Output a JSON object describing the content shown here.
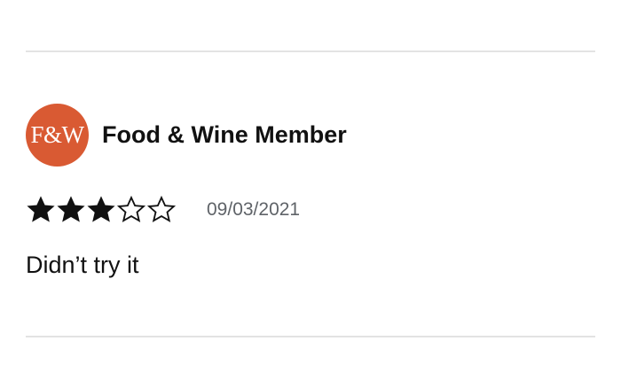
{
  "review": {
    "avatar_text": "F&W",
    "avatar_color": "#d95a33",
    "author": "Food & Wine Member",
    "rating": 3,
    "rating_max": 5,
    "star_icon": "star-icon",
    "date": "09/03/2021",
    "text": "Didn’t try it"
  }
}
